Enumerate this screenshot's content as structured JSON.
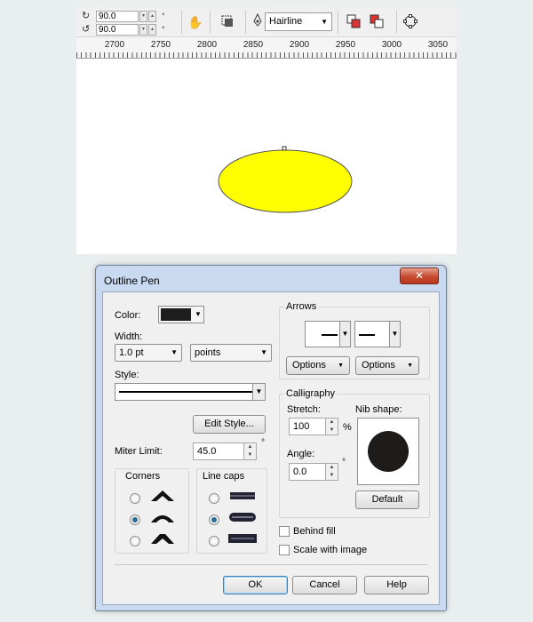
{
  "toolbar": {
    "rotation_x": "90.0",
    "rotation_y": "90.0",
    "degree_symbol": "°",
    "outline_width_value": "Hairline"
  },
  "ruler": {
    "labels": [
      "2700",
      "2750",
      "2800",
      "2850",
      "2900",
      "2950",
      "3000",
      "3050"
    ]
  },
  "canvas": {
    "shape": "ellipse",
    "fill_color": "#ffff00",
    "outline_color": "#555555"
  },
  "dialog": {
    "title": "Outline Pen",
    "close_label": "✕",
    "color_label": "Color:",
    "color_swatch": "#1e1e1e",
    "width_label": "Width:",
    "width_value": "1.0 pt",
    "units_value": "points",
    "style_label": "Style:",
    "edit_style_label": "Edit Style...",
    "miter_limit_label": "Miter Limit:",
    "miter_limit_value": "45.0",
    "degree_symbol": "°",
    "corners_label": "Corners",
    "line_caps_label": "Line caps",
    "corners_selected_index": 1,
    "line_caps_selected_index": 1,
    "arrows_label": "Arrows",
    "options_label": "Options",
    "calligraphy_label": "Calligraphy",
    "stretch_label": "Stretch:",
    "stretch_value": "100",
    "percent_symbol": "%",
    "angle_label": "Angle:",
    "angle_value": "0.0",
    "nib_shape_label": "Nib shape:",
    "default_label": "Default",
    "behind_fill_label": "Behind fill",
    "behind_fill_checked": false,
    "scale_with_image_label": "Scale with image",
    "scale_with_image_checked": false,
    "ok_label": "OK",
    "cancel_label": "Cancel",
    "help_label": "Help"
  }
}
